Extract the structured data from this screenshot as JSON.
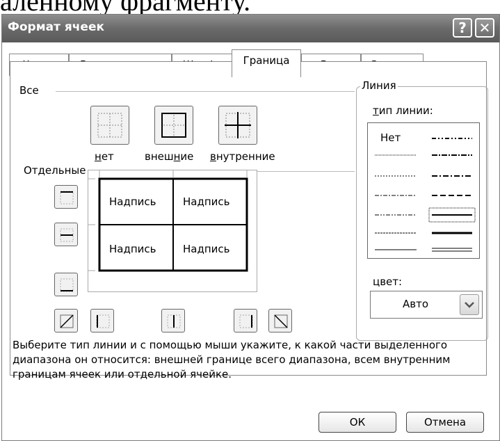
{
  "background": {
    "text": "аленному фрагменту."
  },
  "window": {
    "title": "Формат ячеек",
    "help_glyph": "?",
    "close_glyph": "✕"
  },
  "tabs": [
    {
      "label": "Число"
    },
    {
      "label": "Выравнивание"
    },
    {
      "label": "Шрифт"
    },
    {
      "label": "Граница",
      "active": true
    },
    {
      "label": "Вид"
    },
    {
      "label": "Защита"
    }
  ],
  "all_section": {
    "label": "Все",
    "presets": [
      {
        "label_pre": "",
        "label_u": "н",
        "label_post": "ет"
      },
      {
        "label_pre": "внеш",
        "label_u": "н",
        "label_post": "ие"
      },
      {
        "label_pre": "",
        "label_u": "в",
        "label_post": "нутренние"
      }
    ]
  },
  "separate_section": {
    "label": "Отдельные"
  },
  "preview": {
    "cells": [
      "Надпись",
      "Надпись",
      "Надпись",
      "Надпись"
    ]
  },
  "line_section": {
    "label": "Линия",
    "type_label_u": "т",
    "type_label_rest": "ип линии:",
    "none_label": "Нет",
    "color_label": "цвет:",
    "color_value": "Авто"
  },
  "hint": "Выберите тип линии и с помощью мыши укажите, к какой части выделенного диапазона он относится: внешней границе всего диапазона, всем внутренним границам ячеек или отдельной ячейке.",
  "buttons": {
    "ok": "ОК",
    "cancel": "Отмена"
  }
}
